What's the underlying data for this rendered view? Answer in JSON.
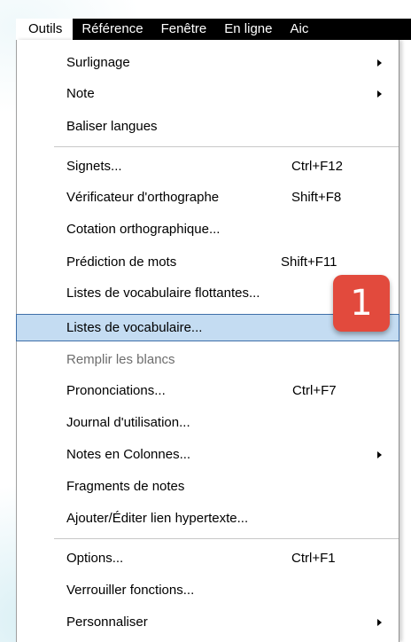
{
  "menubar": {
    "items": [
      "Outils",
      "Référence",
      "Fenêtre",
      "En ligne",
      "Aic"
    ]
  },
  "menu": {
    "items": [
      {
        "label": "Surlignage",
        "shortcut": "",
        "submenu": true,
        "state": "normal"
      },
      {
        "label": "Note",
        "shortcut": "",
        "submenu": true,
        "state": "normal"
      },
      {
        "label": "Baliser langues",
        "shortcut": "",
        "submenu": false,
        "state": "normal"
      },
      {
        "label": "Signets...",
        "shortcut": "Ctrl+F12",
        "submenu": false,
        "state": "normal"
      },
      {
        "label": "Vérificateur d'orthographe",
        "shortcut": "Shift+F8",
        "submenu": false,
        "state": "normal"
      },
      {
        "label": "Cotation orthographique...",
        "shortcut": "",
        "submenu": false,
        "state": "normal"
      },
      {
        "label": "Prédiction de mots",
        "shortcut": "Shift+F11",
        "submenu": false,
        "state": "normal"
      },
      {
        "label": "Listes de vocabulaire flottantes...",
        "shortcut": "",
        "submenu": false,
        "state": "normal"
      },
      {
        "label": "Listes de vocabulaire...",
        "shortcut": "",
        "submenu": false,
        "state": "highlighted"
      },
      {
        "label": "Remplir les blancs",
        "shortcut": "",
        "submenu": false,
        "state": "disabled"
      },
      {
        "label": "Prononciations...",
        "shortcut": "Ctrl+F7",
        "submenu": false,
        "state": "normal"
      },
      {
        "label": "Journal d'utilisation...",
        "shortcut": "",
        "submenu": false,
        "state": "normal"
      },
      {
        "label": "Notes en Colonnes...",
        "shortcut": "",
        "submenu": true,
        "state": "normal"
      },
      {
        "label": "Fragments de notes",
        "shortcut": "",
        "submenu": false,
        "state": "normal"
      },
      {
        "label": "Ajouter/Éditer lien hypertexte...",
        "shortcut": "",
        "submenu": false,
        "state": "normal"
      },
      {
        "label": "Options...",
        "shortcut": "Ctrl+F1",
        "submenu": false,
        "state": "normal"
      },
      {
        "label": "Verrouiller fonctions...",
        "shortcut": "",
        "submenu": false,
        "state": "normal"
      },
      {
        "label": "Personnaliser",
        "shortcut": "",
        "submenu": true,
        "state": "normal"
      }
    ]
  },
  "callout": {
    "number": "1",
    "color": "#e24a3d"
  },
  "colors": {
    "highlight": "#c4dcf2",
    "highlight_border": "#3f6fa8",
    "menubar": "#000000"
  }
}
